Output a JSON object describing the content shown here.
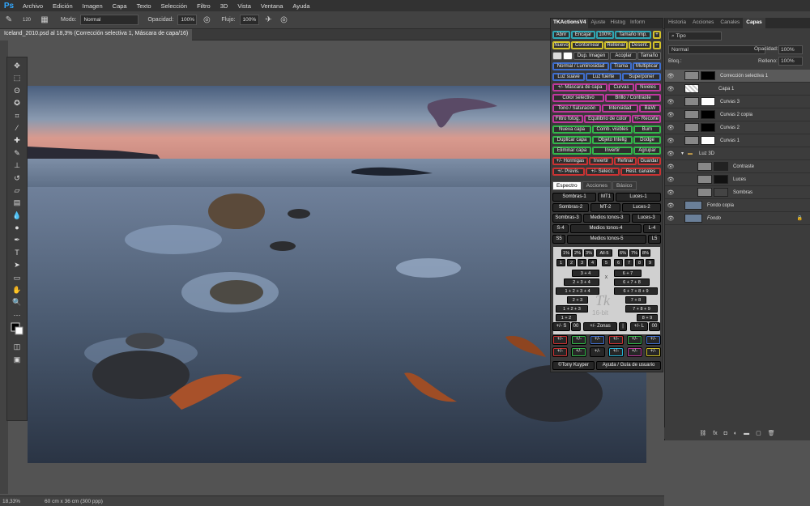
{
  "app": {
    "logo": "Ps"
  },
  "menu": [
    "Archivo",
    "Edición",
    "Imagen",
    "Capa",
    "Texto",
    "Selección",
    "Filtro",
    "3D",
    "Vista",
    "Ventana",
    "Ayuda"
  ],
  "options": {
    "brush_size": "120",
    "modo_label": "Modo:",
    "modo_value": "Normal",
    "opacidad_label": "Opacidad:",
    "opacidad_value": "100%",
    "flujo_label": "Flujo:",
    "flujo_value": "100%"
  },
  "document": {
    "tab": "Iceland_2010.psd al 18,3% (Corrección selectiva 1, Máscara de capa/16)"
  },
  "status": {
    "zoom": "18,33%",
    "size": "60 cm x 36 cm (300 ppp)"
  },
  "tk_panel": {
    "tabs": [
      "TKActionsV4",
      "Ajuste",
      "Histog",
      "Inform"
    ],
    "row1": [
      "Abrir",
      "Encajar",
      "100%",
      "Tamaño Imp."
    ],
    "row2": [
      "Nuevo",
      "Contornear",
      "Rellenar",
      "Desent."
    ],
    "row3": [
      "Dup. Imagen",
      "Acoplar",
      "Tamaño"
    ],
    "rows": [
      [
        "Normal / Luminosidad",
        "Trama",
        "Multiplicar"
      ],
      [
        "Luz suave",
        "Luz fuerte",
        "Superponer"
      ],
      [
        "+/- Máscara de capa",
        "Curvas",
        "Niveles"
      ],
      [
        "Color selectivo",
        "Brillo / Contraste"
      ],
      [
        "Tono / Saturación",
        "Intensidad",
        "B&W"
      ],
      [
        "Filtro fotog.",
        "Equilibrio de color",
        "+/- Recorte"
      ],
      [
        "Nueva capa",
        "Comb. visibles",
        "Burn"
      ],
      [
        "Duplicar capa",
        "Objeto Intelig",
        "Dodge"
      ],
      [
        "Eliminar capa",
        "Invertir",
        "Agrupar"
      ],
      [
        "+/- Hormigas",
        "Invertir",
        "Refinar",
        "Guardar"
      ],
      [
        "+/- Previs.",
        "+/- Selecc.",
        "Rest. canales"
      ]
    ],
    "subtabs": [
      "Espectro",
      "Acciones",
      "Básico"
    ],
    "grid": [
      [
        "Sombras-1",
        "MT1",
        "Luces-1"
      ],
      [
        "Sombras-2",
        "MT-2",
        "Luces-2"
      ],
      [
        "Sombras-3",
        "Medios tonos-3",
        "Luces-3"
      ],
      [
        "S-4",
        "Medios tonos-4",
        "L-4"
      ],
      [
        "S5",
        "Medios tonos-5",
        "L5"
      ]
    ],
    "numpad_top": [
      "1%",
      "2%",
      "3%",
      "All-5",
      "6%",
      "7%",
      "8%"
    ],
    "numpad_nums": [
      "1",
      "2",
      "3",
      "4",
      "5",
      "6",
      "7",
      "8",
      "9"
    ],
    "numpad_combos": [
      "3 + 4",
      "6 + 7",
      "2 + 3 + 4",
      "6 + 7 + 8",
      "1 + 2 + 3 + 4",
      "6 + 7 + 8 + 9",
      "2 + 3",
      "7 + 8",
      "1 + 2 + 3",
      "7 + 8 + 9",
      "1 + 2",
      "8 + 9"
    ],
    "numpad_x": "X",
    "watermark_tk": "Tk",
    "watermark_bit": "16-bit",
    "zones": [
      "+/- S",
      "00",
      "+/- Zonas",
      "|",
      "+/- L",
      "00"
    ],
    "colorbtn": "+/-",
    "footer": [
      "©Tony Kuyper",
      "Ayuda / Guía de usuario"
    ]
  },
  "right_panel": {
    "tabs": [
      "Historia",
      "Acciones",
      "Canales",
      "Capas"
    ],
    "filter": "Tipo",
    "blend": "Normal",
    "opacity_label": "Opacidad:",
    "opacity": "100%",
    "lock_label": "Bloq.:",
    "fill_label": "Relleno:",
    "fill": "100%",
    "layers": [
      {
        "name": "Corrección selectiva 1",
        "thumb": "#000000"
      },
      {
        "name": "Capa 1",
        "thumb": "checker"
      },
      {
        "name": "Curvas 3",
        "thumb": "#ffffff"
      },
      {
        "name": "Curvas 2 copia",
        "thumb": "#000000"
      },
      {
        "name": "Curvas 2",
        "thumb": "#000000"
      },
      {
        "name": "Curvas 1",
        "thumb": "#ffffff"
      },
      {
        "name": "Luz 3D",
        "thumb": ""
      },
      {
        "name": "Contraste",
        "thumb": "#222222"
      },
      {
        "name": "Luces",
        "thumb": "#111111"
      },
      {
        "name": "Sombras",
        "thumb": "#444444"
      },
      {
        "name": "Fondo copia",
        "thumb": "#6a7f98"
      },
      {
        "name": "Fondo",
        "thumb": "#6a7f98"
      }
    ]
  }
}
